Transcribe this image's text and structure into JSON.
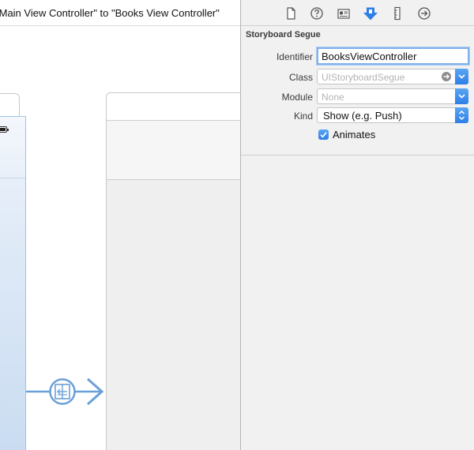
{
  "canvas": {
    "segue_title": "\"Main View Controller\" to \"Books View Controller\""
  },
  "inspector": {
    "toolbar_icons": [
      "file-icon",
      "help-icon",
      "identity-icon",
      "attributes-icon",
      "size-icon",
      "connections-icon"
    ],
    "active_tab": "attributes-icon",
    "section_title": "Storyboard Segue",
    "identifier": {
      "label": "Identifier",
      "value": "BooksViewController"
    },
    "class": {
      "label": "Class",
      "placeholder": "UIStoryboardSegue"
    },
    "module": {
      "label": "Module",
      "placeholder": "None"
    },
    "kind": {
      "label": "Kind",
      "value": "Show (e.g. Push)"
    },
    "animates": {
      "label": "Animates",
      "checked": true
    }
  },
  "colors": {
    "accent": "#2d7ee6",
    "segue_line": "#6aa0d8",
    "inspector_bg": "#f1f1f1"
  }
}
